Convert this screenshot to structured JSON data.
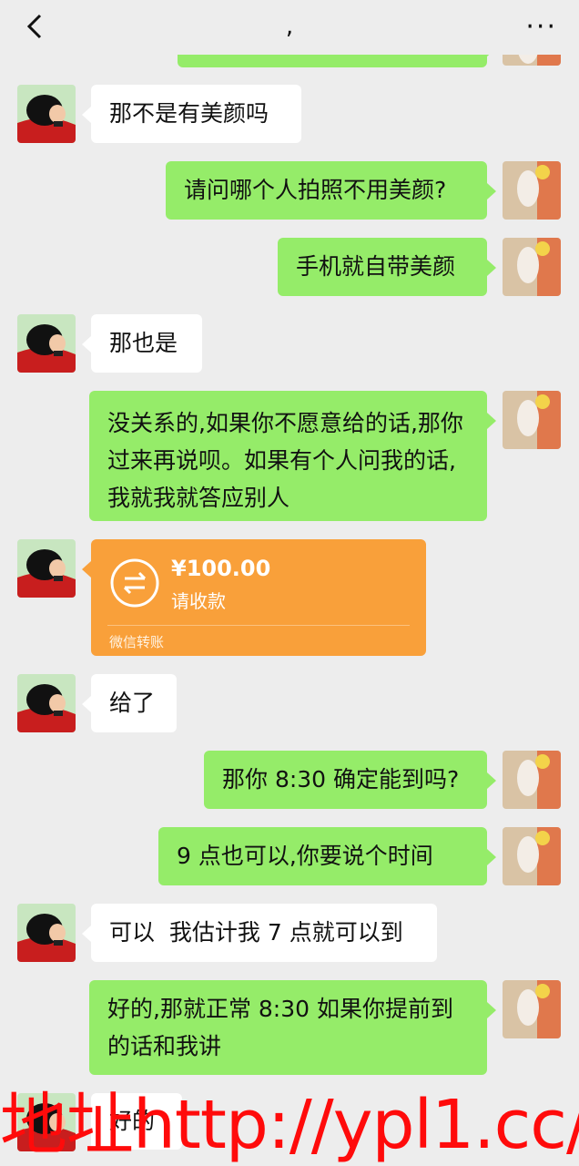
{
  "header": {
    "title": ",",
    "back_icon": "chevron-left-icon",
    "more_label": "···"
  },
  "messages": {
    "m1": "那不是有美颜吗",
    "m2": "请问哪个人拍照不用美颜?",
    "m3": "手机就自带美颜",
    "m4": "那也是",
    "m5": "没关系的,如果你不愿意给的话,那你过来再说呗。如果有个人问我的话,我就我就答应别人",
    "m7": "给了",
    "m8": "那你 8:30 确定能到吗?",
    "m9": "9 点也可以,你要说个时间",
    "m10": "可以  我估计我 7 点就可以到",
    "m11": "好的,那就正常 8:30 如果你提前到的话和我讲",
    "m12": "好的"
  },
  "transfer": {
    "amount": "¥100.00",
    "note": "请收款",
    "footer": "微信转账",
    "icon": "transfer-arrows-icon"
  },
  "watermark": {
    "text": "地址http://ypl1.cc/"
  },
  "colors": {
    "background": "#ededed",
    "green_bubble": "#95ec69",
    "white_bubble": "#ffffff",
    "transfer": "#f9a03a",
    "watermark": "#ff0b0b"
  }
}
